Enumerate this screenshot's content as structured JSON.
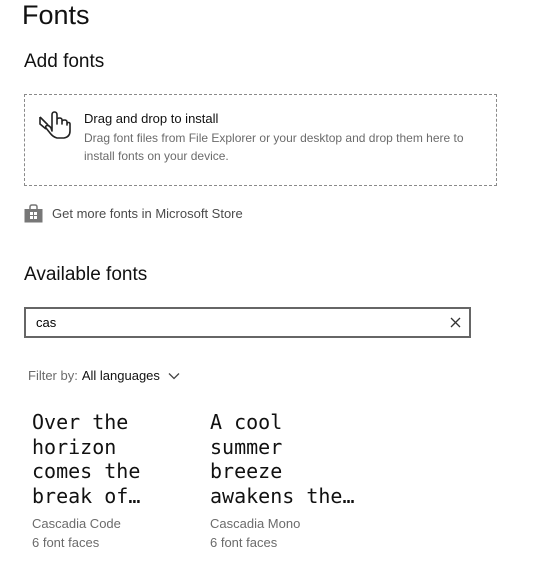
{
  "page": {
    "title": "Fonts"
  },
  "add_fonts": {
    "heading": "Add fonts",
    "drop_title": "Drag and drop to install",
    "drop_desc": "Drag font files from File Explorer or your desktop and drop them here to install fonts on your device.",
    "drop_icon": "hand-pointer-icon",
    "store_icon": "store-bag-icon",
    "store_link": "Get more fonts in Microsoft Store"
  },
  "available_fonts": {
    "heading": "Available fonts",
    "search_value": "cas",
    "clear_icon": "close-icon",
    "filter_label": "Filter by:",
    "filter_value": "All languages",
    "filter_icon": "chevron-down-icon",
    "fonts": [
      {
        "preview_lines": [
          "Over the",
          "horizon",
          "comes the",
          "break of…"
        ],
        "name": "Cascadia Code",
        "faces": "6 font faces"
      },
      {
        "preview_lines": [
          "A cool",
          "summer",
          "breeze",
          "awakens the…"
        ],
        "name": "Cascadia Mono",
        "faces": "6 font faces"
      }
    ]
  },
  "colors": {
    "text": "#111111",
    "muted": "#6b6b6b",
    "border": "#666666"
  }
}
